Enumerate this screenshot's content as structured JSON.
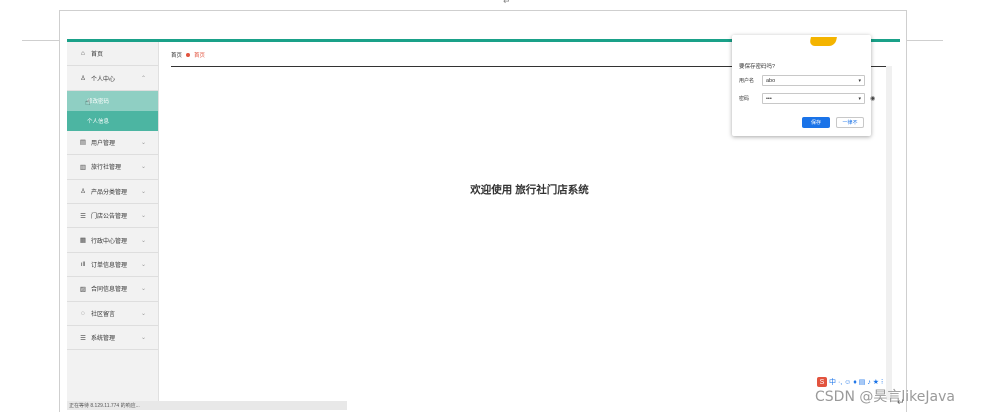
{
  "sidebar": {
    "items": [
      {
        "icon": "home-icon",
        "glyph": "⌂",
        "label": "首页",
        "chevron": ""
      },
      {
        "icon": "user-icon",
        "glyph": "♙",
        "label": "个人中心",
        "chevron": "⌃"
      },
      {
        "icon": "book-icon",
        "glyph": "▤",
        "label": "用户管理",
        "chevron": "⌄"
      },
      {
        "icon": "grid-icon",
        "glyph": "▥",
        "label": "旅行社管理",
        "chevron": "⌄"
      },
      {
        "icon": "user-icon",
        "glyph": "♙",
        "label": "产品分类管理",
        "chevron": "⌄"
      },
      {
        "icon": "list-icon",
        "glyph": "☰",
        "label": "门店公告管理",
        "chevron": "⌄"
      },
      {
        "icon": "doc-icon",
        "glyph": "▦",
        "label": "行政中心管理",
        "chevron": "⌄"
      },
      {
        "icon": "chart-icon",
        "glyph": "ıll",
        "label": "订单信息管理",
        "chevron": "⌄"
      },
      {
        "icon": "bank-icon",
        "glyph": "▨",
        "label": "合同信息管理",
        "chevron": "⌄"
      },
      {
        "icon": "chat-icon",
        "glyph": "◌",
        "label": "社区留言",
        "chevron": "⌄"
      },
      {
        "icon": "menu-icon",
        "glyph": "☰",
        "label": "系统管理",
        "chevron": "⌄"
      }
    ],
    "subitems": [
      {
        "label": "修改密码"
      },
      {
        "label": "个人信息"
      }
    ]
  },
  "breadcrumb": {
    "root": "首页",
    "current": "首页"
  },
  "main": {
    "welcome": "欢迎使用 旅行社门店系统"
  },
  "password_popup": {
    "title": "要保存密码吗?",
    "username_label": "用户名",
    "username_value": "abo",
    "password_label": "密码",
    "password_value": "•••",
    "save_label": "保存",
    "never_label": "一律不"
  },
  "status_bar": {
    "text": "正在等待 8.129.11.774 的响应..."
  },
  "watermark": {
    "text": "CSDN @昊言likeJava"
  },
  "ime": {
    "logo": "S",
    "glyphs": "中 ·, ☺ ♦ ▤ ♪ ★ ⁝"
  },
  "colors": {
    "accent": "#1aa189",
    "submenu_light": "#8fcfc3",
    "submenu_dark": "#4cb5a2",
    "breadcrumb_red": "#e2533e",
    "chrome_blue": "#1a73e8"
  }
}
